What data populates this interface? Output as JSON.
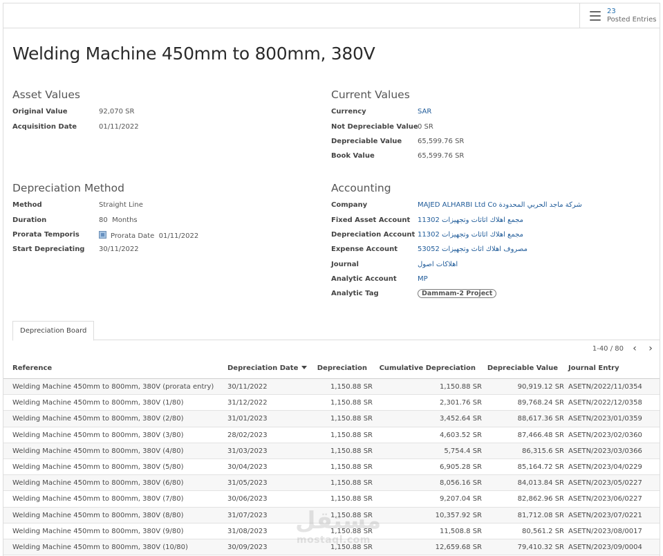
{
  "button_box": {
    "count": "23",
    "label": "Posted Entries"
  },
  "title": "Welding Machine 450mm to 800mm, 380V",
  "asset_values": {
    "heading": "Asset Values",
    "original_value_label": "Original Value",
    "original_value": "92,070 SR",
    "acquisition_date_label": "Acquisition Date",
    "acquisition_date": "01/11/2022"
  },
  "current_values": {
    "heading": "Current Values",
    "currency_label": "Currency",
    "currency": "SAR",
    "not_depreciable_label": "Not Depreciable Value",
    "not_depreciable": "0 SR",
    "depreciable_label": "Depreciable Value",
    "depreciable": "65,599.76 SR",
    "book_value_label": "Book Value",
    "book_value": "65,599.76 SR"
  },
  "depreciation_method": {
    "heading": "Depreciation Method",
    "method_label": "Method",
    "method": "Straight Line",
    "duration_label": "Duration",
    "duration_value": "80",
    "duration_unit": "Months",
    "prorata_label": "Prorata Temporis",
    "prorata_date_label": "Prorata Date",
    "prorata_date": "01/11/2022",
    "start_label": "Start Depreciating",
    "start": "30/11/2022"
  },
  "accounting": {
    "heading": "Accounting",
    "company_label": "Company",
    "company": "MAJED ALHARBI Ltd Co شركة ماجد الحربي المحدودة",
    "fixed_asset_label": "Fixed Asset Account",
    "fixed_asset": "11302 مجمع اهلاك اثاثات وتجهيزات",
    "depreciation_account_label": "Depreciation Account",
    "depreciation_account": "11302 مجمع اهلاك اثاثات وتجهيزات",
    "expense_label": "Expense Account",
    "expense": "53052 مصروف اهلاك اثاث وتجهيزات",
    "journal_label": "Journal",
    "journal": "اهلاكات اصول",
    "analytic_account_label": "Analytic Account",
    "analytic_account": "MP",
    "analytic_tag_label": "Analytic Tag",
    "analytic_tag": "Dammam-2 Project"
  },
  "tabs": [
    {
      "label": "Depreciation Board"
    }
  ],
  "pager": {
    "text": "1-40 / 80"
  },
  "table": {
    "headers": {
      "reference": "Reference",
      "date": "Depreciation Date",
      "depreciation": "Depreciation",
      "cumulative": "Cumulative Depreciation",
      "depreciable": "Depreciable Value",
      "journal_entry": "Journal Entry"
    },
    "rows": [
      {
        "reference": "Welding Machine 450mm to 800mm, 380V (prorata entry)",
        "date": "30/11/2022",
        "depreciation": "1,150.88 SR",
        "cumulative": "1,150.88 SR",
        "depreciable": "90,919.12 SR",
        "entry": "ASETN/2022/11/0354"
      },
      {
        "reference": "Welding Machine 450mm to 800mm, 380V (1/80)",
        "date": "31/12/2022",
        "depreciation": "1,150.88 SR",
        "cumulative": "2,301.76 SR",
        "depreciable": "89,768.24 SR",
        "entry": "ASETN/2022/12/0358"
      },
      {
        "reference": "Welding Machine 450mm to 800mm, 380V (2/80)",
        "date": "31/01/2023",
        "depreciation": "1,150.88 SR",
        "cumulative": "3,452.64 SR",
        "depreciable": "88,617.36 SR",
        "entry": "ASETN/2023/01/0359"
      },
      {
        "reference": "Welding Machine 450mm to 800mm, 380V (3/80)",
        "date": "28/02/2023",
        "depreciation": "1,150.88 SR",
        "cumulative": "4,603.52 SR",
        "depreciable": "87,466.48 SR",
        "entry": "ASETN/2023/02/0360"
      },
      {
        "reference": "Welding Machine 450mm to 800mm, 380V (4/80)",
        "date": "31/03/2023",
        "depreciation": "1,150.88 SR",
        "cumulative": "5,754.4 SR",
        "depreciable": "86,315.6 SR",
        "entry": "ASETN/2023/03/0366"
      },
      {
        "reference": "Welding Machine 450mm to 800mm, 380V (5/80)",
        "date": "30/04/2023",
        "depreciation": "1,150.88 SR",
        "cumulative": "6,905.28 SR",
        "depreciable": "85,164.72 SR",
        "entry": "ASETN/2023/04/0229"
      },
      {
        "reference": "Welding Machine 450mm to 800mm, 380V (6/80)",
        "date": "31/05/2023",
        "depreciation": "1,150.88 SR",
        "cumulative": "8,056.16 SR",
        "depreciable": "84,013.84 SR",
        "entry": "ASETN/2023/05/0227"
      },
      {
        "reference": "Welding Machine 450mm to 800mm, 380V (7/80)",
        "date": "30/06/2023",
        "depreciation": "1,150.88 SR",
        "cumulative": "9,207.04 SR",
        "depreciable": "82,862.96 SR",
        "entry": "ASETN/2023/06/0227"
      },
      {
        "reference": "Welding Machine 450mm to 800mm, 380V (8/80)",
        "date": "31/07/2023",
        "depreciation": "1,150.88 SR",
        "cumulative": "10,357.92 SR",
        "depreciable": "81,712.08 SR",
        "entry": "ASETN/2023/07/0221"
      },
      {
        "reference": "Welding Machine 450mm to 800mm, 380V (9/80)",
        "date": "31/08/2023",
        "depreciation": "1,150.88 SR",
        "cumulative": "11,508.8 SR",
        "depreciable": "80,561.2 SR",
        "entry": "ASETN/2023/08/0017"
      },
      {
        "reference": "Welding Machine 450mm to 800mm, 380V (10/80)",
        "date": "30/09/2023",
        "depreciation": "1,150.88 SR",
        "cumulative": "12,659.68 SR",
        "depreciable": "79,410.32 SR",
        "entry": "ASETN/2023/09/0004"
      }
    ]
  },
  "watermark": {
    "arabic": "مستقل",
    "latin": "mostaql.com"
  }
}
